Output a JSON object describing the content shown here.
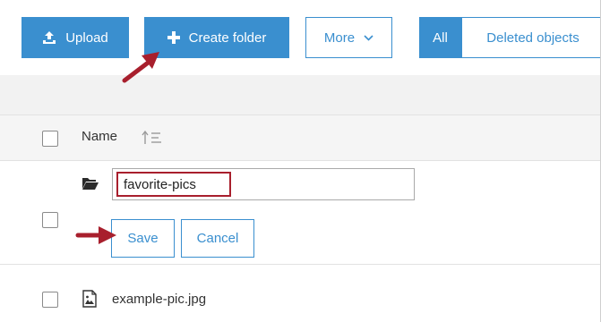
{
  "toolbar": {
    "upload_label": "Upload",
    "create_folder_label": "Create folder",
    "more_label": "More",
    "all_label": "All",
    "deleted_objects_label": "Deleted objects"
  },
  "table": {
    "header_name": "Name"
  },
  "new_folder": {
    "input_value": "favorite-pics",
    "save_label": "Save",
    "cancel_label": "Cancel"
  },
  "files": [
    {
      "name": "example-pic.jpg",
      "icon": "image-file-icon"
    }
  ],
  "colors": {
    "primary": "#3a8fcf",
    "highlight": "#a81f2d",
    "header_bg": "#f5f5f5"
  }
}
